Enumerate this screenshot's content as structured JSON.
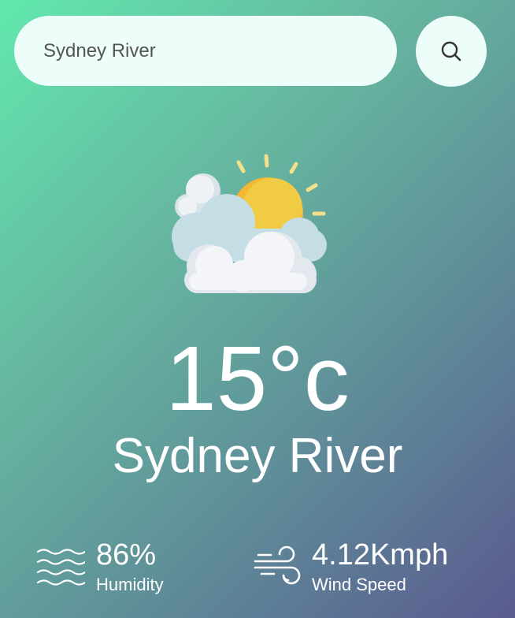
{
  "search": {
    "value": "Sydney River",
    "button_icon": "search-icon"
  },
  "weather": {
    "icon": "partly-cloudy-icon",
    "temperature": "15°c",
    "city": "Sydney River"
  },
  "details": {
    "humidity": {
      "icon": "humidity-waves-icon",
      "value": "86%",
      "label": "Humidity"
    },
    "wind": {
      "icon": "wind-icon",
      "value": "4.12Kmph",
      "label": "Wind Speed"
    }
  },
  "colors": {
    "gradient_start": "#62e8ae",
    "gradient_end": "#5a5a8f",
    "input_bg": "#edfdf9",
    "sun": "#f4b731",
    "cloud": "#f1f4f6"
  }
}
